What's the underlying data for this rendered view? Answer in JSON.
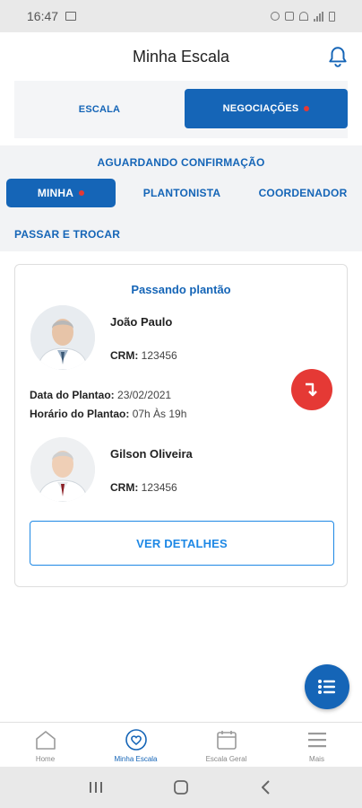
{
  "status_bar": {
    "time": "16:47"
  },
  "header": {
    "title": "Minha Escala"
  },
  "segments": {
    "escala": "ESCALA",
    "negociacoes": "NEGOCIAÇÕES"
  },
  "subtabs": {
    "aguardando": "AGUARDANDO CONFIRMAÇÃO",
    "minha": "MINHA",
    "plantonista": "PLANTONISTA",
    "coordenador": "COORDENADOR",
    "passar_trocar": "PASSAR E TROCAR"
  },
  "card": {
    "title": "Passando plantão",
    "doctor_from": {
      "name": "João Paulo",
      "crm_label": "CRM:",
      "crm": "123456"
    },
    "date_label": "Data do Plantao:",
    "date_value": "23/02/2021",
    "time_label": "Horário do Plantao:",
    "time_value": "07h Às 19h",
    "doctor_to": {
      "name": "Gilson Oliveira",
      "crm_label": "CRM:",
      "crm": "123456"
    },
    "details_button": "VER DETALHES"
  },
  "bottom_nav": {
    "home": "Home",
    "minha_escala": "Minha Escala",
    "escala_geral": "Escala Geral",
    "mais": "Mais"
  },
  "colors": {
    "primary": "#1565b7",
    "accent_red": "#e53935",
    "outline_blue": "#1e88e5"
  }
}
